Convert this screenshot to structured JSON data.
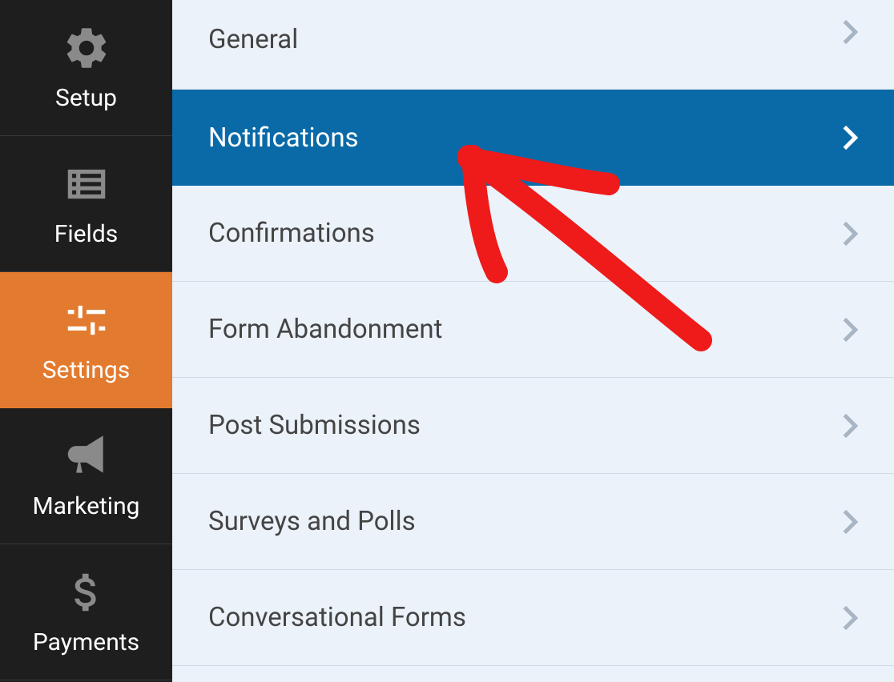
{
  "sidebar": {
    "items": [
      {
        "label": "Setup",
        "icon": "gear-icon",
        "active": false
      },
      {
        "label": "Fields",
        "icon": "list-icon",
        "active": false
      },
      {
        "label": "Settings",
        "icon": "sliders-icon",
        "active": true
      },
      {
        "label": "Marketing",
        "icon": "bullhorn-icon",
        "active": false
      },
      {
        "label": "Payments",
        "icon": "dollar-icon",
        "active": false
      }
    ]
  },
  "settings_panel": {
    "items": [
      {
        "label": "General",
        "active": false
      },
      {
        "label": "Notifications",
        "active": true
      },
      {
        "label": "Confirmations",
        "active": false
      },
      {
        "label": "Form Abandonment",
        "active": false
      },
      {
        "label": "Post Submissions",
        "active": false
      },
      {
        "label": "Surveys and Polls",
        "active": false
      },
      {
        "label": "Conversational Forms",
        "active": false
      }
    ]
  },
  "colors": {
    "sidebar_bg": "#1e1e1e",
    "sidebar_active": "#e27b2f",
    "panel_bg": "#ebf2f9",
    "panel_active": "#0a6aa8",
    "annotation": "#ef1a1a"
  }
}
